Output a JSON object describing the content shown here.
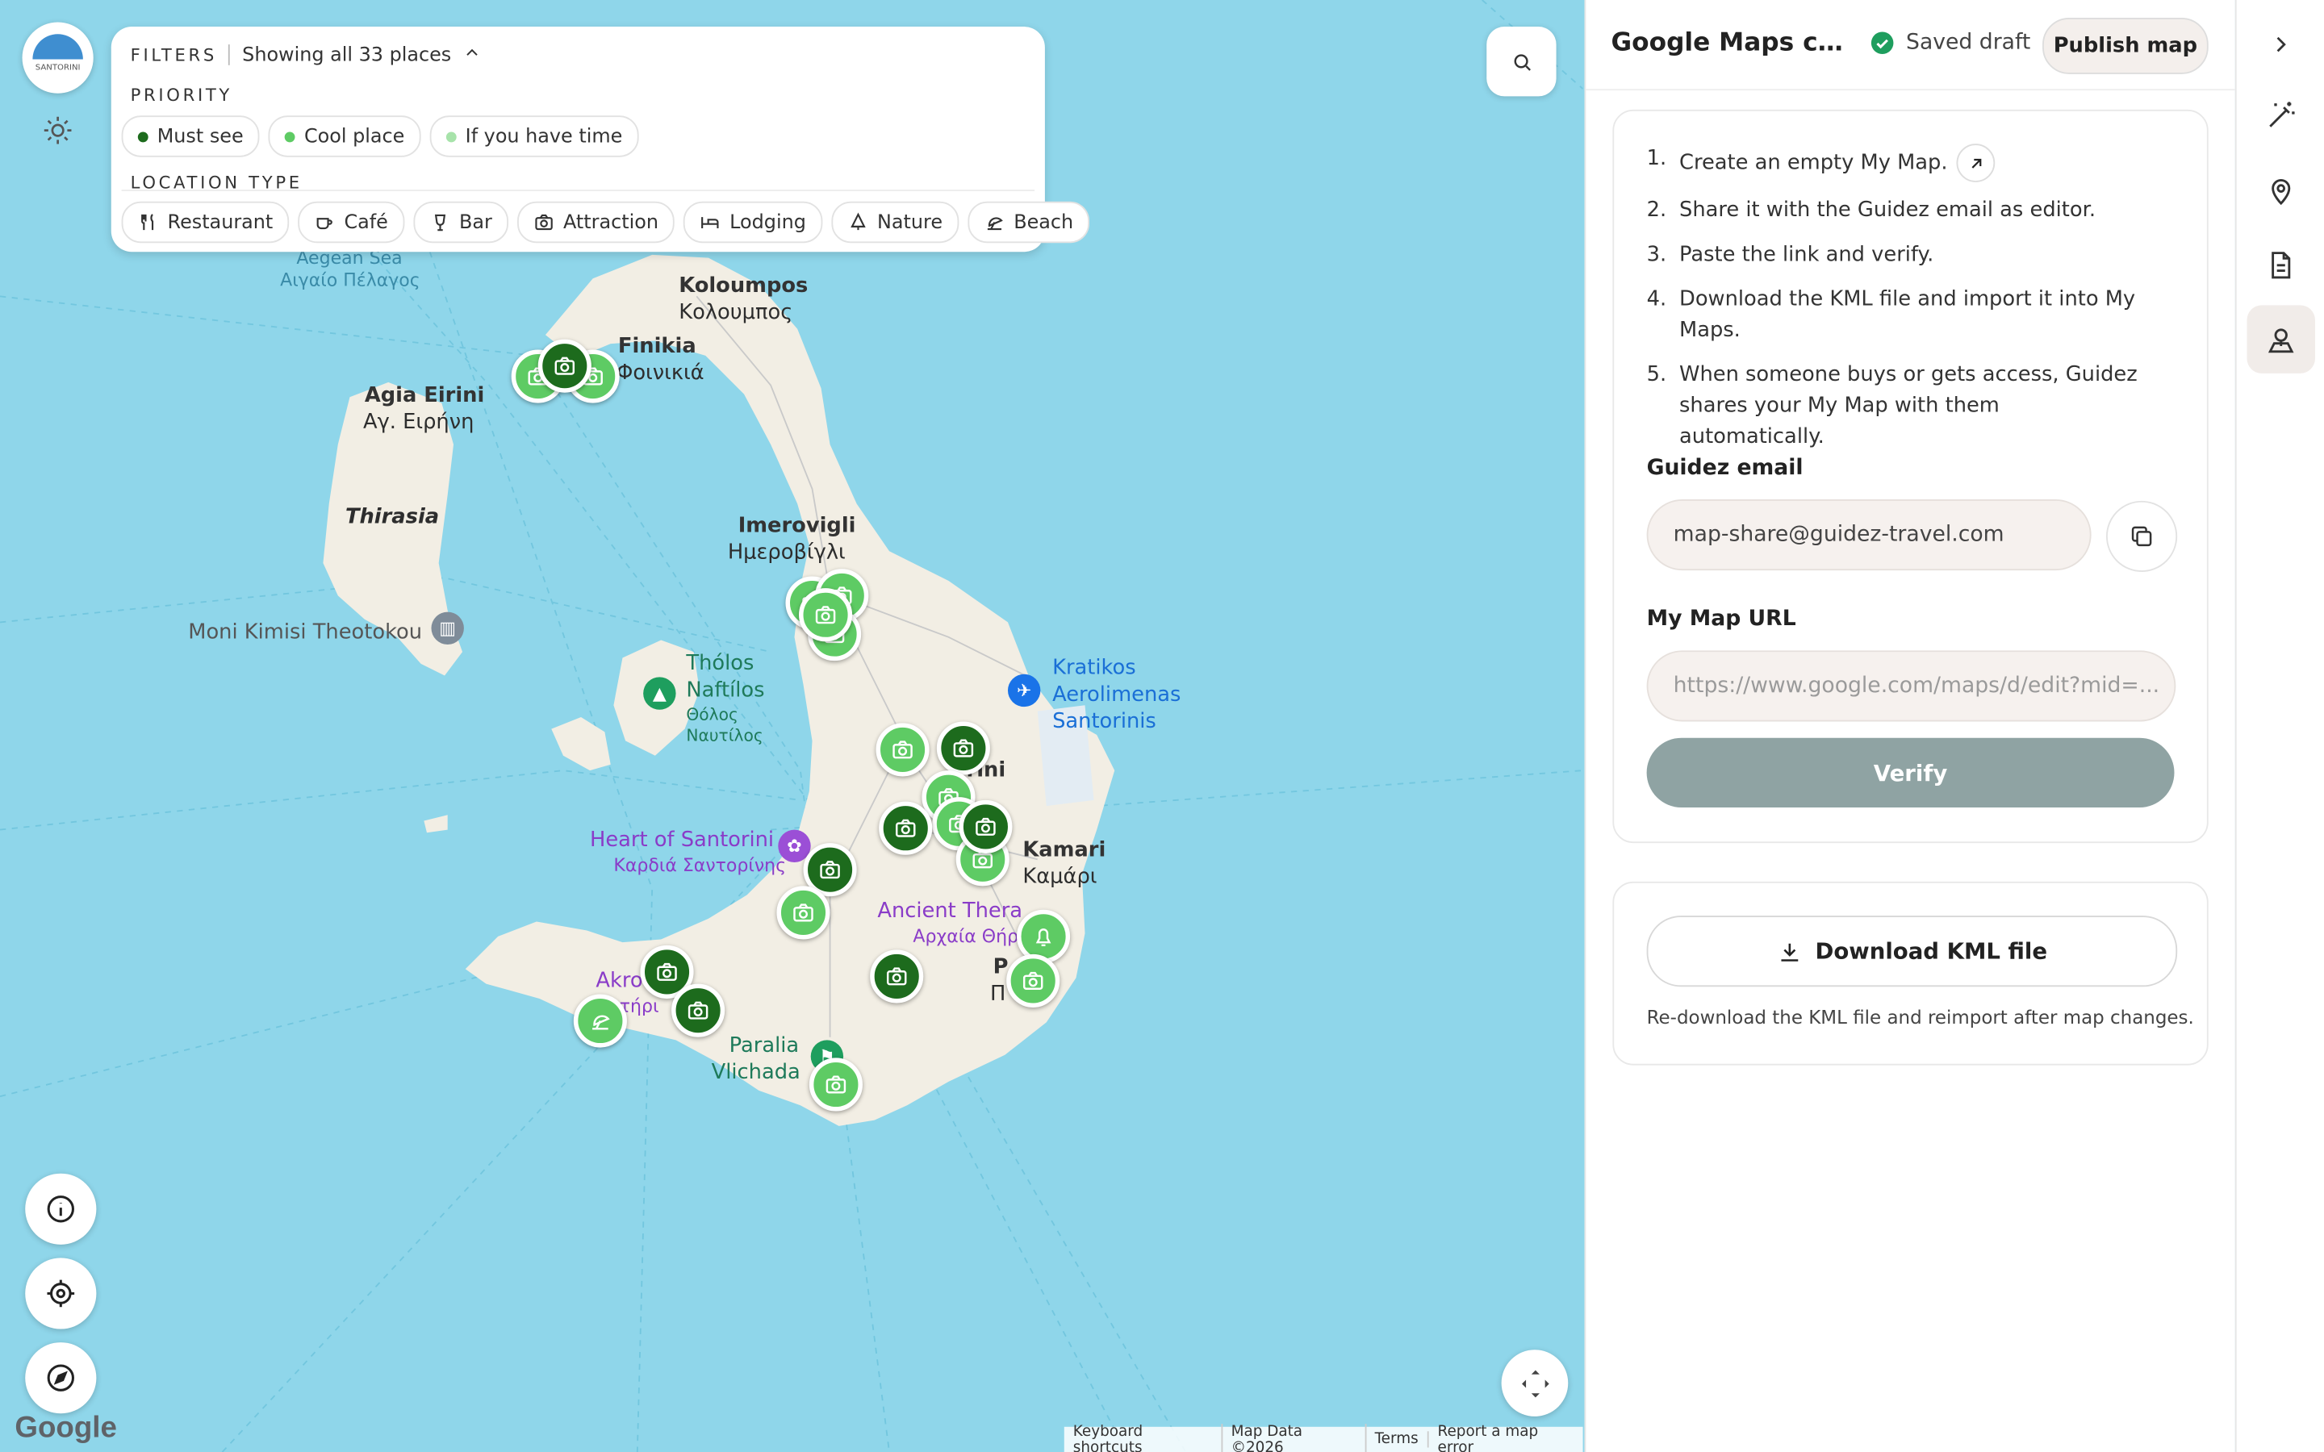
{
  "filters": {
    "title": "FILTERS",
    "showing": "Showing all 33 places",
    "priority_title": "PRIORITY",
    "priority": [
      {
        "label": "Must see",
        "color": "#1d6b1d"
      },
      {
        "label": "Cool place",
        "color": "#5ecb64"
      },
      {
        "label": "If you have time",
        "color": "#a7e3aa"
      }
    ],
    "location_title": "LOCATION TYPE",
    "types": [
      {
        "label": "Restaurant",
        "icon": "fork-knife-icon"
      },
      {
        "label": "Café",
        "icon": "coffee-cup-icon"
      },
      {
        "label": "Bar",
        "icon": "cocktail-icon"
      },
      {
        "label": "Attraction",
        "icon": "camera-icon"
      },
      {
        "label": "Lodging",
        "icon": "bed-icon"
      },
      {
        "label": "Nature",
        "icon": "tree-icon"
      },
      {
        "label": "Beach",
        "icon": "umbrella-icon"
      }
    ]
  },
  "map": {
    "labels": {
      "aegean_en": "Aegean Sea",
      "aegean_gr": "Αιγαίο Πέλαγος",
      "koloumpos_en": "Koloumpos",
      "koloumpos_gr": "Κολουμπος",
      "finikia_en": "Finikia",
      "finikia_gr": "Φοινικιά",
      "agia_eirini_en": "Agia Eirini",
      "agia_eirini_gr": "Αγ. Ειρήνη",
      "thirasia": "Thirasia",
      "moni": "Moni Kimisi Theotokou",
      "imerovigli_en": "Imerovigli",
      "imerovigli_gr": "Ημεροβίγλι",
      "tholos_en1": "Thólos",
      "tholos_en2": "Naftílos",
      "tholos_gr1": "Θόλος",
      "tholos_gr2": "Ναυτίλος",
      "kratikos1": "Kratikos",
      "kratikos2": "Aerolimenas",
      "kratikos3": "Santorinis",
      "heart_en": "Heart of Santorini",
      "heart_gr": "Καρδιά Σαντορίνης",
      "kamari_en": "Kamari",
      "kamari_gr": "Καμάρι",
      "ancient_en": "Ancient Thera",
      "ancient_gr": "Αρχαία Θήρα",
      "akro_en": "Akro",
      "akro_gr": "τήρι",
      "perissa_en": "P        a",
      "perissa_gr": "Π         α",
      "fira_frag": "rini",
      "paraliav1": "Paralia",
      "paraliav2": "Vlichada"
    },
    "google_logo": "Google",
    "attribution": [
      "Keyboard shortcuts",
      "Map Data ©2026",
      "Terms",
      "Report a map error"
    ]
  },
  "panel": {
    "title": "Google Maps con...",
    "status": "Saved draft",
    "publish": "Publish map",
    "steps": [
      "Create an empty My Map.",
      "Share it with the Guidez email as editor.",
      "Paste the link and verify.",
      "Download the KML file and import it into My Maps.",
      "When someone buys or gets access, Guidez shares your My Map with them automatically."
    ],
    "step_numbers": [
      "1.",
      "2.",
      "3.",
      "4.",
      "5."
    ],
    "email_label": "Guidez email",
    "email_value": "map-share@guidez-travel.com",
    "url_label": "My Map URL",
    "url_placeholder": "https://www.google.com/maps/d/edit?mid=...",
    "verify": "Verify",
    "download": "Download KML file",
    "download_note": "Re-download the KML file and reimport after map changes."
  },
  "logo_text": "SANTORINI"
}
